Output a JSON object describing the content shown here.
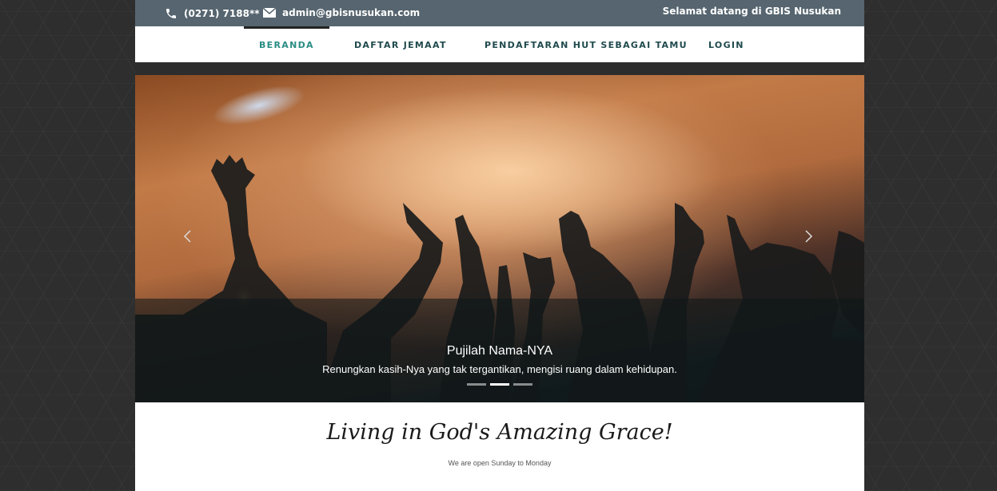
{
  "topbar": {
    "phone": "(0271) 7188**",
    "email": "admin@gbisnusukan.com",
    "welcome": "Selamat datang di GBIS Nusukan",
    "phone_icon": "phone-icon",
    "email_icon": "envelope-icon"
  },
  "nav": {
    "items": [
      {
        "label": "BERANDA",
        "active": true
      },
      {
        "label": "DAFTAR JEMAAT",
        "active": false
      },
      {
        "label": "PENDAFTARAN HUT SEBAGAI TAMU",
        "active": false
      },
      {
        "label": "LOGIN",
        "active": false
      }
    ]
  },
  "carousel": {
    "title": "Pujilah Nama-NYA",
    "text": "Renungkan kasih-Nya yang tak tergantikan, mengisi ruang dalam kehidupan.",
    "slide_count": 3,
    "active_slide": 2,
    "prev_icon": "chevron-left-icon",
    "next_icon": "chevron-right-icon"
  },
  "intro": {
    "heading": "Living in God's Amazing Grace!",
    "subtext": "We are open Sunday to Monday"
  },
  "colors": {
    "topbar_bg": "#56656f",
    "nav_active": "#2a8d84",
    "nav_text": "#1f4a4d",
    "page_bg": "#2e2e2e"
  }
}
